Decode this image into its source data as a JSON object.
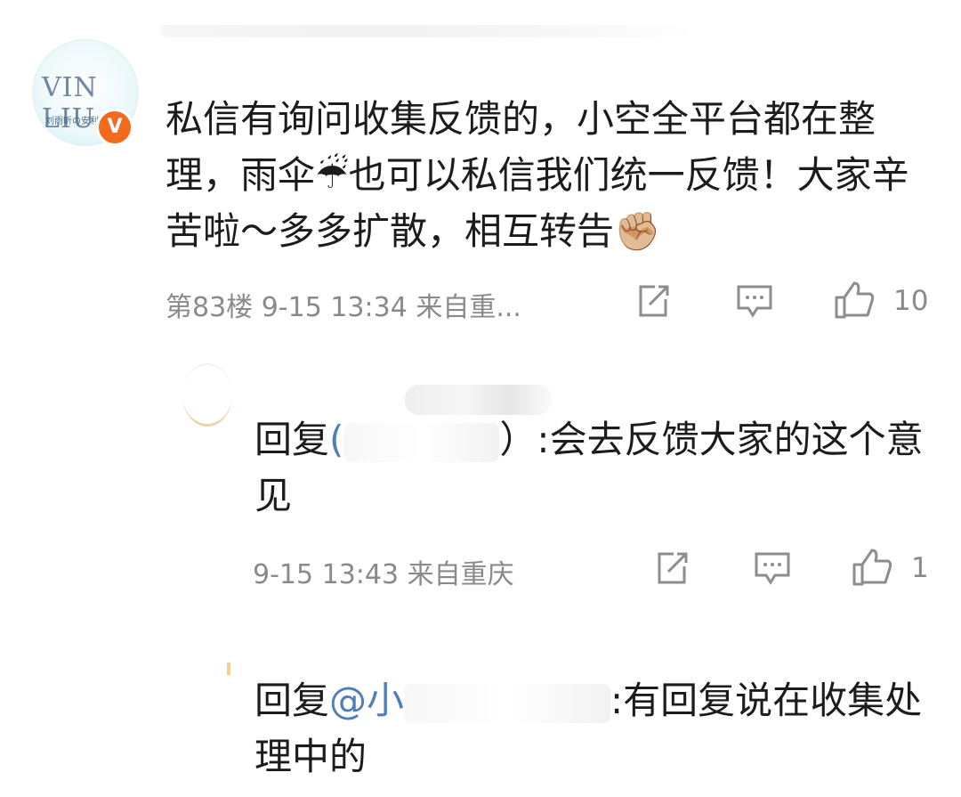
{
  "comment": {
    "text": "私信有询问收集反馈的，小空全平台都在整理，雨伞☔也可以私信我们统一反馈！大家辛苦啦～多多扩散，相互转告✊🏼",
    "avatar_label_main": "VIN LIU",
    "avatar_label_sub": "刘雨昕の安利昕空",
    "badge": "V",
    "meta": "第83楼 9-15 13:34 来自重...",
    "like_count": "10"
  },
  "replies": [
    {
      "prefix": "回复",
      "mention_start": "(",
      "mention_end": "）",
      "text": ":会去反馈大家的这个意见",
      "meta": "9-15 13:43 来自重庆",
      "like_count": "1"
    },
    {
      "prefix": "回复",
      "mention_start": "@小",
      "text": ":有回复说在收集处理中的"
    }
  ],
  "icons": [
    "share-icon",
    "comment-icon",
    "like-icon"
  ]
}
